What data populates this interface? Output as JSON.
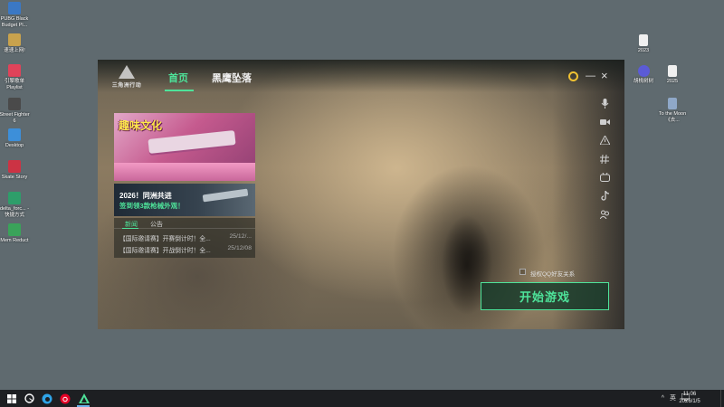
{
  "desktop": {
    "left_icons": [
      {
        "name": "pubg-black-budget",
        "label": "PUBG Black Budget Pl...",
        "color": "#3b78c4"
      },
      {
        "name": "app-2",
        "label": "速速上网!",
        "color": "#c8a24d"
      },
      {
        "name": "netease-music",
        "label": "引擎歌单 Playlist",
        "color": "#e0435a"
      },
      {
        "name": "street-fighter-6",
        "label": "Street Fighter 6",
        "color": "#4a4a4a"
      },
      {
        "name": "desktop-folder",
        "label": "Desktop",
        "color": "#3d8fd9"
      },
      {
        "name": "skate-story",
        "label": "Skate Story",
        "color": "#cc3344"
      },
      {
        "name": "delta-force",
        "label": "delta_forc... - 快捷方式",
        "color": "#2e9e6a"
      },
      {
        "name": "mem-reduct",
        "label": "Mem Reduct",
        "color": "#3aa35a"
      }
    ],
    "right_icons": [
      {
        "name": "file-2023",
        "label": "2023",
        "color": "#f0f0f0"
      },
      {
        "name": "app-right",
        "label": "胡桃树树",
        "color": "#5b5bd6"
      },
      {
        "name": "file-2025",
        "label": "2025",
        "color": "#f0f0f0"
      },
      {
        "name": "to-the-moon",
        "label": "To the Moon《去...",
        "color": "#8fa8c8"
      }
    ]
  },
  "launcher": {
    "logo_text": "三角洲行动",
    "tabs": [
      {
        "label": "首页",
        "active": true
      },
      {
        "label": "黑鹰坠落",
        "active": false
      }
    ],
    "window_controls": {
      "minimize": "—",
      "close": "×"
    },
    "side_icons": [
      "microphone-icon",
      "video-icon",
      "warning-icon",
      "hashtag-icon",
      "bilibili-icon",
      "tiktok-icon",
      "community-icon"
    ],
    "banner1": {
      "title": "趣味文化"
    },
    "banner2": {
      "line1": "2026！同洲共进",
      "line2": "签到领3款枪械外观！"
    },
    "news": {
      "tabs": [
        {
          "label": "新闻",
          "active": true
        },
        {
          "label": "公告",
          "active": false
        }
      ],
      "items": [
        {
          "title": "【国际邀请赛】开赛倒计时！全...",
          "date": "25/12/..."
        },
        {
          "title": "【国际邀请赛】开战倒计时！全...",
          "date": "25/12/08"
        }
      ]
    },
    "auth": {
      "label": "授权QQ好友关系",
      "checked": false
    },
    "start_button": {
      "label": "开始游戏"
    },
    "accent_color": "#4ee39a"
  },
  "taskbar": {
    "icons": [
      "windows-start-icon",
      "search-icon",
      "edge-icon",
      "netease-cloud-music-icon",
      "delta-force-taskbar-icon"
    ],
    "tray": {
      "chevron": "^",
      "ime": "英"
    },
    "clock": {
      "time": "11:06",
      "date": "2026/1/5"
    }
  }
}
